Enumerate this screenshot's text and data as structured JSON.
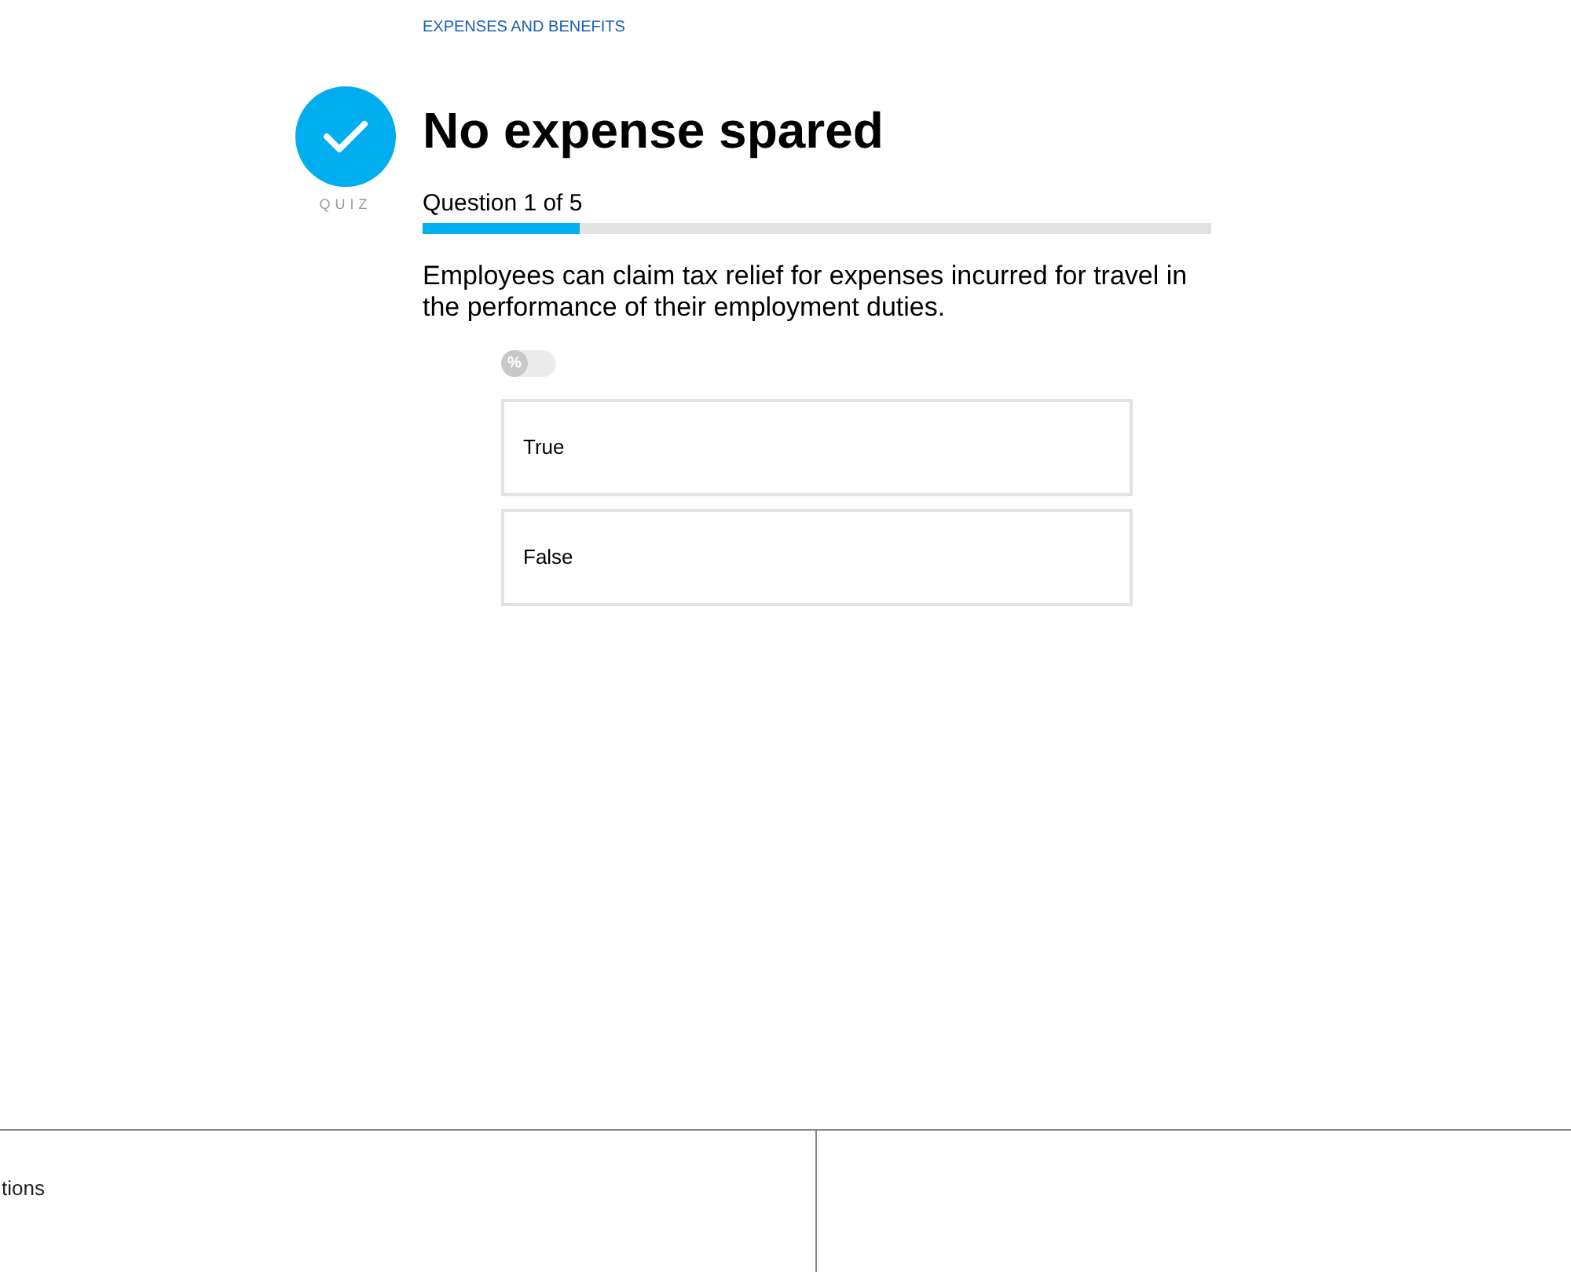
{
  "breadcrumb": "EXPENSES AND BENEFITS",
  "badge": {
    "label": "QUIZ"
  },
  "title": "No expense spared",
  "progress": {
    "label": "Question 1 of 5",
    "level": 0.2
  },
  "question": "Employees can claim tax relief for expenses incurred for travel in the performance of their employment duties.",
  "percent_toggle": {
    "symbol": "%",
    "on": false
  },
  "answers": [
    {
      "label": "True",
      "selected": false
    },
    {
      "label": "False",
      "selected": false
    }
  ],
  "footer": {
    "left_text": "tions"
  }
}
